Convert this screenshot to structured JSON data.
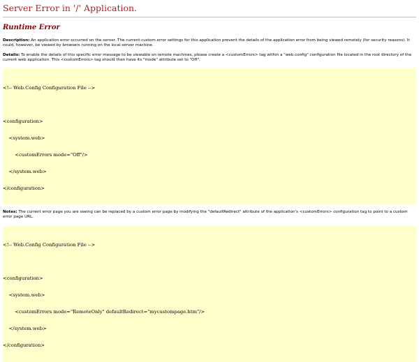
{
  "page": {
    "title": "Server Error in '/' Application.",
    "subtitle": "Runtime Error"
  },
  "description": {
    "label": "Description:",
    "text": " An application error occurred on the server. The current custom error settings for this application prevent the details of the application error from being viewed remotely (for security reasons). It could, however, be viewed by browsers running on the local server machine."
  },
  "details": {
    "label": "Details:",
    "text": " To enable the details of this specific error message to be viewable on remote machines, please create a <customErrors> tag within a \"web.config\" configuration file located in the root directory of the current web application. This <customErrors> tag should then have its \"mode\" attribute set to \"Off\"."
  },
  "code_block_1": {
    "lines": [
      "<!-- Web.Config Configuration File -->",
      "",
      "<configuration>",
      "    <system.web>",
      "        <customErrors mode=\"Off\"/>",
      "    </system.web>",
      "</configuration>"
    ]
  },
  "notes": {
    "label": "Notes:",
    "text": " The current error page you are seeing can be replaced by a custom error page by modifying the \"defaultRedirect\" attribute of the application's <customErrors> configuration tag to point to a custom error page URL."
  },
  "code_block_2": {
    "lines": [
      "<!-- Web.Config Configuration File -->",
      "",
      "<configuration>",
      "    <system.web>",
      "        <customErrors mode=\"RemoteOnly\" defaultRedirect=\"mycustompage.htm\"/>",
      "    </system.web>",
      "</configuration>"
    ]
  },
  "colors": {
    "title": "#b22222",
    "subtitle": "#8b0000",
    "code_background": "#ffffcc"
  }
}
